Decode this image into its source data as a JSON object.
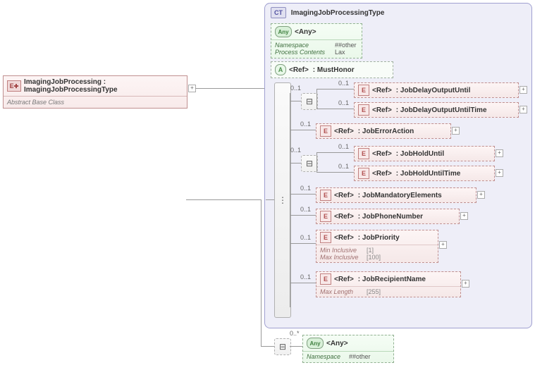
{
  "root": {
    "badge": "E",
    "label": "ImagingJobProcessing : ImagingJobProcessingType",
    "sub": "Abstract Base Class"
  },
  "ct": {
    "badge": "CT",
    "title": "ImagingJobProcessingType"
  },
  "any_top": {
    "badge": "Any",
    "label": "<Any>",
    "namespace_k": "Namespace",
    "namespace_v": "##other",
    "proc_k": "Process Contents",
    "proc_v": "Lax"
  },
  "musthonor": {
    "badge": "A",
    "ref": "<Ref>",
    "name": ": MustHonor"
  },
  "refs": {
    "jdou": {
      "ref": "<Ref>",
      "name": ": JobDelayOutputUntil"
    },
    "jdout": {
      "ref": "<Ref>",
      "name": ": JobDelayOutputUntilTime"
    },
    "jea": {
      "ref": "<Ref>",
      "name": ": JobErrorAction"
    },
    "jhu": {
      "ref": "<Ref>",
      "name": ": JobHoldUntil"
    },
    "jhut": {
      "ref": "<Ref>",
      "name": ": JobHoldUntilTime"
    },
    "jme": {
      "ref": "<Ref>",
      "name": ": JobMandatoryElements"
    },
    "jpn": {
      "ref": "<Ref>",
      "name": ": JobPhoneNumber"
    },
    "jpri": {
      "ref": "<Ref>",
      "name": ": JobPriority",
      "min_k": "Min Inclusive",
      "min_v": "[1]",
      "max_k": "Max Inclusive",
      "max_v": "[100]"
    },
    "jrn": {
      "ref": "<Ref>",
      "name": ": JobRecipientName",
      "ml_k": "Max Length",
      "ml_v": "[255]"
    }
  },
  "occ": {
    "opt": "0..1",
    "many": "0..*"
  },
  "any_bottom": {
    "badge": "Any",
    "label": "<Any>",
    "namespace_k": "Namespace",
    "namespace_v": "##other"
  },
  "badges": {
    "e": "E"
  },
  "glyph": {
    "plus": "+"
  }
}
